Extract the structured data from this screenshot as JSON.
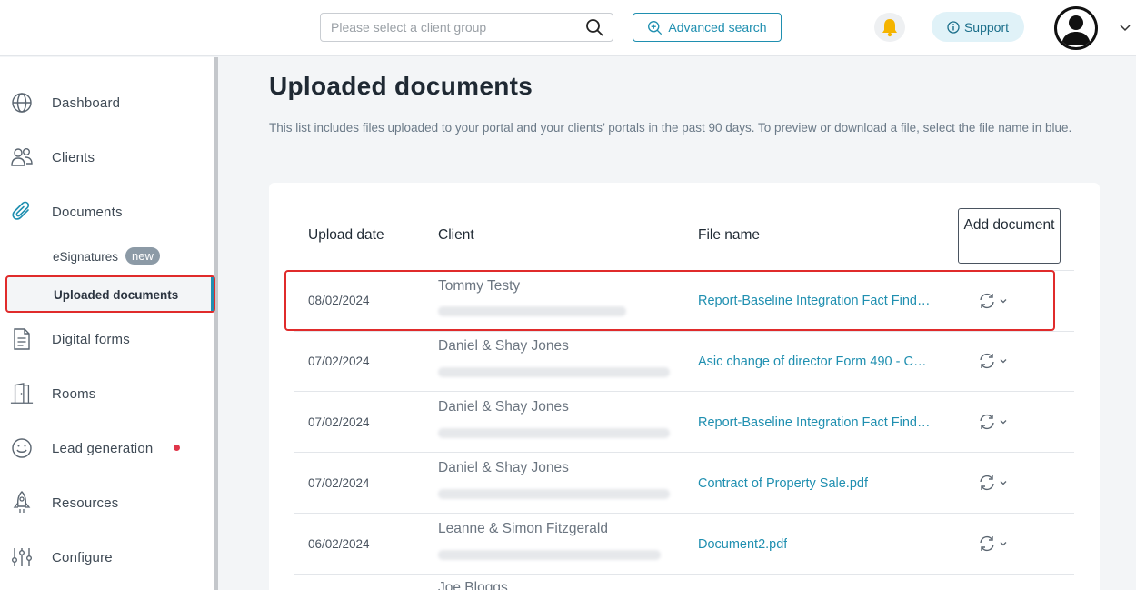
{
  "header": {
    "search_placeholder": "Please select a client group",
    "advanced_search_label": "Advanced search",
    "support_label": "Support"
  },
  "sidebar": {
    "items": [
      {
        "label": "Dashboard",
        "icon": "globe-icon"
      },
      {
        "label": "Clients",
        "icon": "users-icon"
      },
      {
        "label": "Documents",
        "icon": "paperclip-icon"
      },
      {
        "label": "Digital forms",
        "icon": "form-icon"
      },
      {
        "label": "Rooms",
        "icon": "door-icon"
      },
      {
        "label": "Lead generation",
        "icon": "smile-icon"
      },
      {
        "label": "Resources",
        "icon": "rocket-icon"
      },
      {
        "label": "Configure",
        "icon": "sliders-icon"
      }
    ],
    "sub_items": {
      "esignatures": "eSignatures",
      "esignatures_badge": "new",
      "uploaded_documents": "Uploaded documents"
    }
  },
  "main": {
    "title": "Uploaded documents",
    "description": "This list includes files uploaded to your portal and your clients’ portals in the past 90 days. To preview or download a file, select the file name in blue.",
    "columns": {
      "upload_date": "Upload date",
      "client": "Client",
      "file_name": "File name"
    },
    "add_document_label": "Add document",
    "rows": [
      {
        "date": "08/02/2024",
        "client": "Tommy Testy",
        "file": "Report-Baseline Integration Fact Find -…"
      },
      {
        "date": "07/02/2024",
        "client": "Daniel & Shay Jones",
        "file": "Asic change of director Form 490 - Co…"
      },
      {
        "date": "07/02/2024",
        "client": "Daniel & Shay Jones",
        "file": "Report-Baseline Integration Fact Find -…"
      },
      {
        "date": "07/02/2024",
        "client": "Daniel & Shay Jones",
        "file": "Contract of Property Sale.pdf"
      },
      {
        "date": "06/02/2024",
        "client": "Leanne & Simon Fitzgerald",
        "file": "Document2.pdf"
      },
      {
        "date": "",
        "client": "Joe Bloggs",
        "file": ""
      }
    ]
  },
  "colors": {
    "accent": "#1f8fb0",
    "highlight": "#e02b2b",
    "bell": "#f5b400"
  }
}
